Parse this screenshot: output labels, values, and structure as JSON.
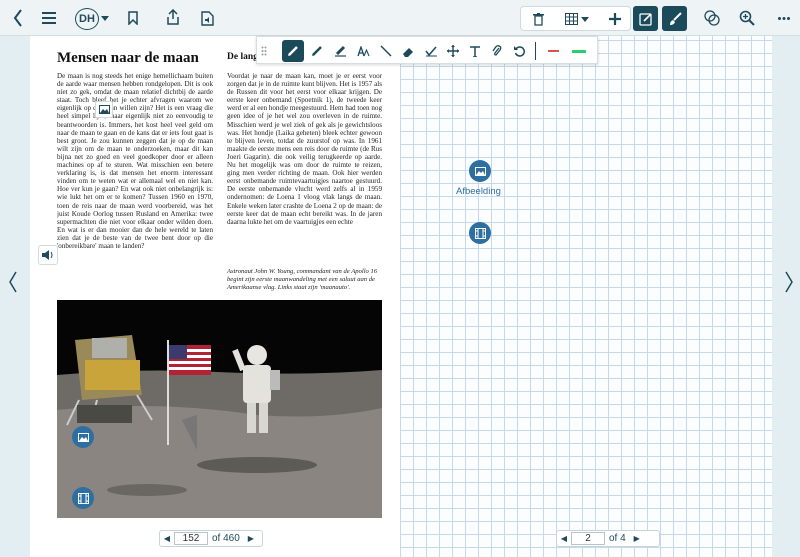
{
  "toolbar": {
    "avatar_initials": "DH"
  },
  "article": {
    "title": "Mensen naar de maan",
    "title2": "De langz",
    "col1": "De maan is nog steeds het enige hemellichaam buiten de aarde waar mensen hebben rondgelopen. Dit is ook niet zo gek, omdat de maan relatief dichtbij de aarde staat. Toch bleef het je echter afvragen waarom we eigenlijk op de maan willen zijn? Het is een vraag die heel simpel lijkt, maar eigenlijk niet zo eenvoudig te beantwoorden is. Immers, het kost heel veel geld om naar de maan te gaan en de kans dat er iets fout gaat is best groot. Je zou kunnen zeggen dat je op de maan wilt zijn om de maan te onderzoeken, maar dit kan bijna net zo goed en veel goedkoper door er alleen machines op af te sturen. Wat misschien een betere verklaring is, is dat mensen het enorm interessant vinden om te weten wat er allemaal wel en niet kan. Hoe ver kun je gaan? En wat ook niet onbelangrijk is: wie lukt het om er te komen? Tussen 1960 en 1970, toen de reis naar de maan werd voorbereid, was het juist Koude Oorlog tussen Rusland en Amerika: twee supermachten die niet voor elkaar onder wilden doen. En wat is er dan mooier dan de hele wereld te laten zien dat je de beste van de twee bent door op die 'onbereikbare' maan te landen?",
    "col2": "Voordat je naar de maan kan, moet je er eerst voor zorgen dat je in de ruimte kunt blijven. Het is 1957 als de Russen dit voor het eerst voor elkaar krijgen. De eerste keer onbemand (Spoetnik 1), de tweede keer werd er al een hondje meegestuurd. Hem had toen nog geen idee of je het wel zou overleven in de ruimte. Misschien werd je wel ziek of gek als je gewichtsloos was. Het hondje (Laika geheten) bleek echter gewoon te blijven leven, totdat de zuurstof op was. In 1961 maakte de eerste mens een reis door de ruimte (de Rus Joeri Gagarin). die ook veilig terugkeerde op aarde. Nu het mogelijk was om door de ruimte te reizen, ging men verder richting de maan. Ook hier werden eerst onbemande ruimtevaartuigjes naartoe gestuurd. De eerste onbemande vlucht werd zelfs al in 1959 ondernomen: de Loena 1 vloog vlak langs de maan. Enkele weken later crashte de Loena 2 op de maan: de eerste keer dat de maan echt bereikt was. In de jaren daarna lukte het om de vaartuigjes een echte",
    "caption": "Astronaut John W. Young, commandant van de Apollo 16 begint zijn eerste maanwandeling met een saluut aan de Amerikaanse vlag. Links staat zijn 'maanauto'."
  },
  "left_pager": {
    "current": "152",
    "total": "of 460"
  },
  "right_pager": {
    "current": "2",
    "total": "of 4"
  },
  "right_panel": {
    "image_label": "Afbeelding"
  },
  "colors": {
    "accent": "#1b4a5b",
    "red": "#d9534f",
    "green": "#2ecc71",
    "blue": "#2d6fa0"
  }
}
